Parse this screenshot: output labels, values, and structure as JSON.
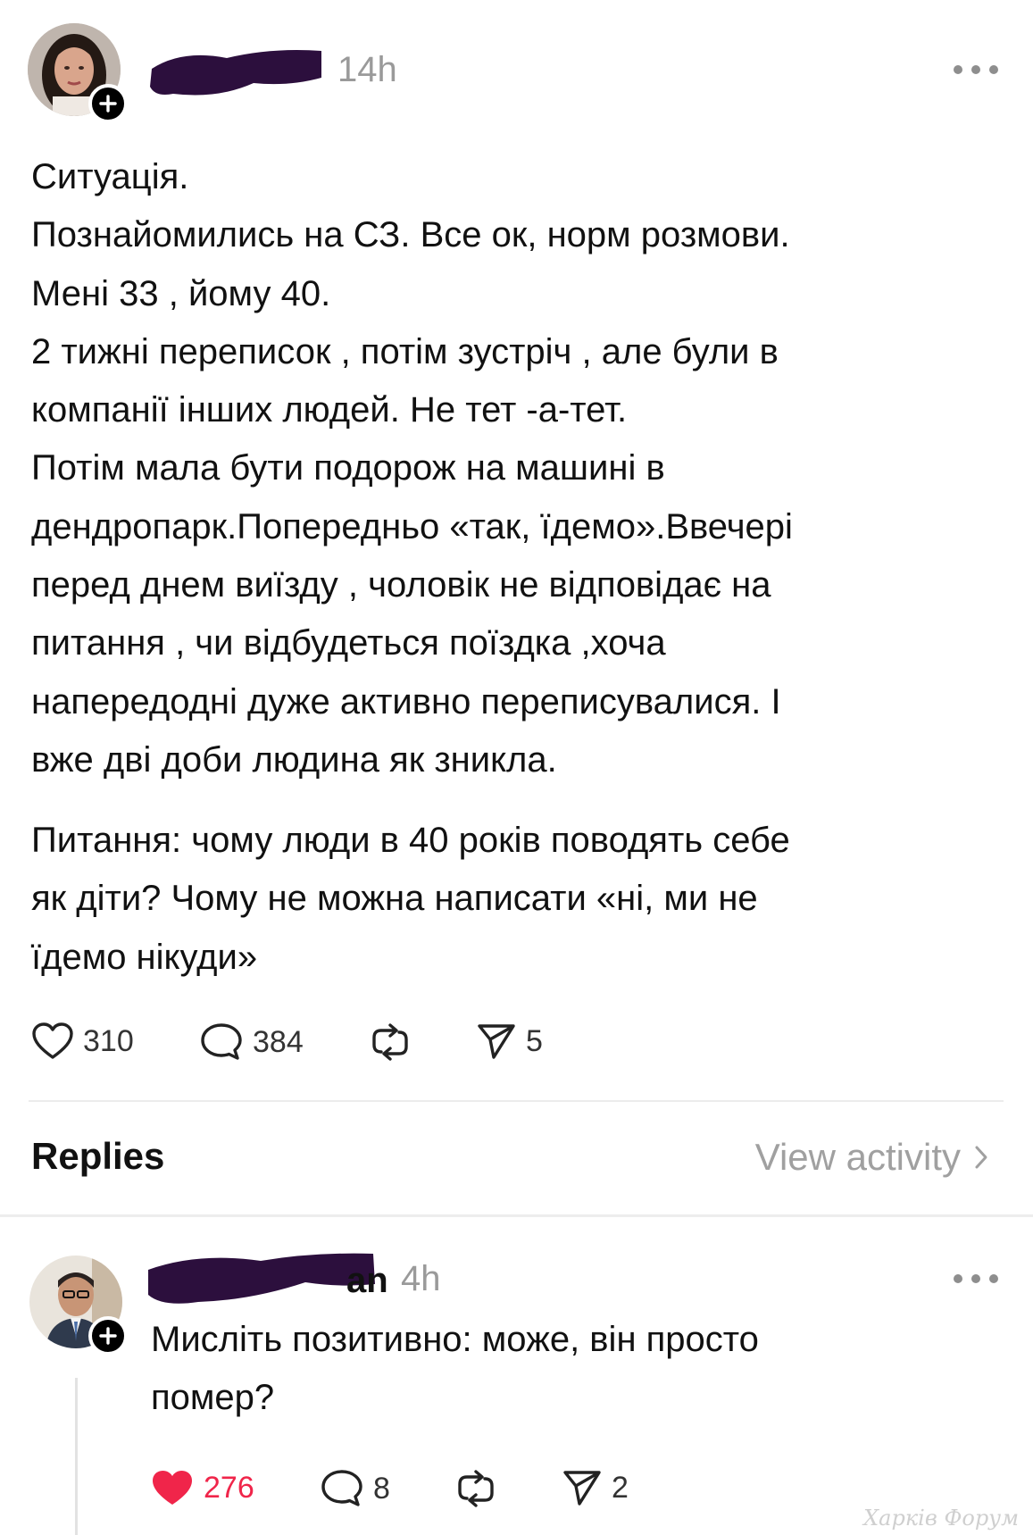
{
  "post": {
    "time": "14h",
    "paragraphs": [
      [
        "Ситуація.",
        "Познайомились на СЗ. Все ок, норм розмови.",
        "Мені 33 , йому 40.",
        "2 тижні переписок , потім зустріч , але були в",
        "компанії інших людей. Не тет -а-тет.",
        "Потім мала бути подорож на машині в",
        "дендропарк.Попередньо «так, їдемо».Ввечері",
        "перед днем виїзду , чоловік не відповідає на",
        "питання , чи відбудеться поїздка ,хоча",
        "напередодні дуже активно переписувалися. І",
        "вже дві доби людина як зникла."
      ],
      [
        "Питання: чому люди в 40 років поводять  себе",
        "як діти? Чому не можна написати «ні, ми не",
        "їдемо нікуди»"
      ]
    ],
    "likes": "310",
    "comments": "384",
    "shares": "5"
  },
  "replies_section": {
    "title": "Replies",
    "view_activity": "View activity"
  },
  "reply": {
    "name_visible": "an",
    "time": "4h",
    "lines": [
      "Мисліть позитивно: може, він просто",
      "помер?"
    ],
    "likes": "276",
    "comments": "8",
    "shares": "2"
  },
  "watermark": "Харків Форум",
  "colors": {
    "like_active": "#f0254a",
    "muted": "#9a9a9a",
    "redaction": "#2c0f3d"
  }
}
